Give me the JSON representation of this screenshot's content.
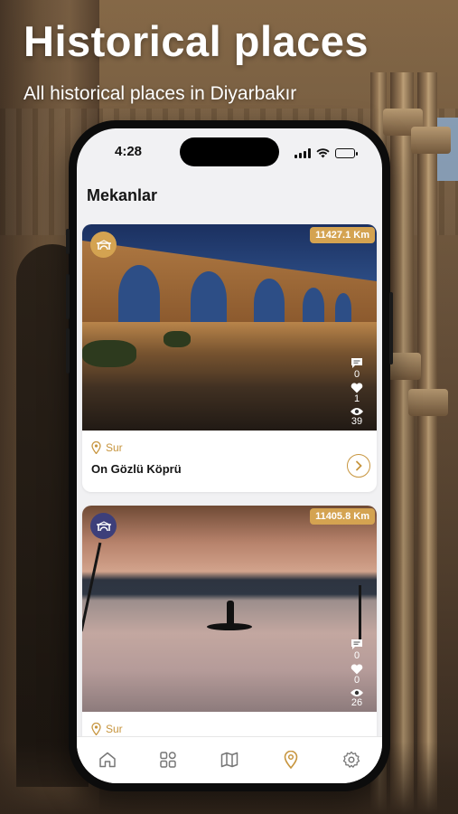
{
  "hero": {
    "title": "Historical places",
    "subtitle": "All historical places in Diyarbakır"
  },
  "status_bar": {
    "time": "4:28"
  },
  "page": {
    "title": "Mekanlar"
  },
  "places": [
    {
      "distance": "11427.1 Km",
      "comments": "0",
      "likes": "1",
      "views": "39",
      "location": "Sur",
      "name": "On Gözlü Köprü",
      "badge_icon": "bridge-icon",
      "badge_color": "#d4a351"
    },
    {
      "distance": "11405.8 Km",
      "comments": "0",
      "likes": "0",
      "views": "26",
      "location": "Sur",
      "name": "",
      "badge_icon": "bridge-icon",
      "badge_color": "#3d3f7a"
    }
  ],
  "tabbar": {
    "items": [
      "home-icon",
      "grid-icon",
      "map-icon",
      "location-pin-icon",
      "settings-icon"
    ],
    "active_index": 3
  },
  "colors": {
    "accent": "#c7953e",
    "distance_badge": "#d4a351"
  }
}
